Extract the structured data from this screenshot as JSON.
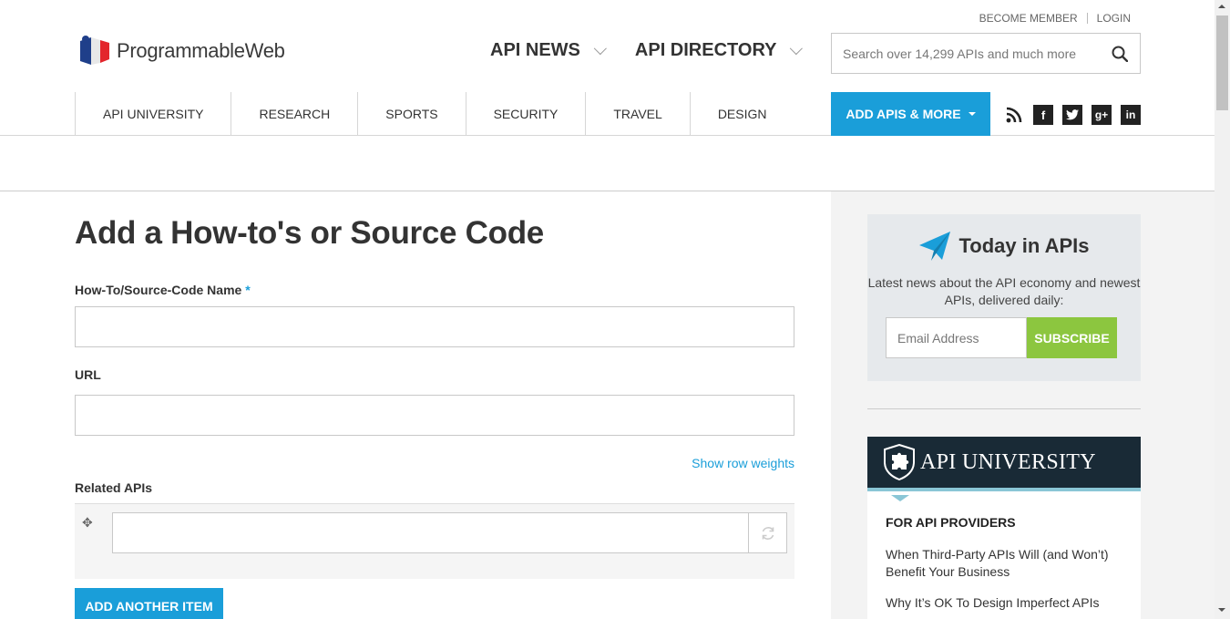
{
  "header": {
    "logo_text": "ProgrammableWeb",
    "top_links": {
      "become_member": "BECOME MEMBER",
      "login": "LOGIN"
    },
    "nav": [
      {
        "label": "API NEWS"
      },
      {
        "label": "API DIRECTORY"
      }
    ],
    "search": {
      "placeholder": "Search over 14,299 APIs and much more",
      "value": ""
    }
  },
  "subnav": {
    "items": [
      {
        "label": "API UNIVERSITY"
      },
      {
        "label": "RESEARCH"
      },
      {
        "label": "SPORTS"
      },
      {
        "label": "SECURITY"
      },
      {
        "label": "TRAVEL"
      },
      {
        "label": "DESIGN"
      }
    ],
    "add_button": "ADD APIS & MORE",
    "social_icons": [
      "rss-icon",
      "facebook-icon",
      "twitter-icon",
      "google-plus-icon",
      "linkedin-icon"
    ]
  },
  "form": {
    "title": "Add a How-to's or Source Code",
    "name_label": "How-To/Source-Code Name",
    "required_mark": "*",
    "name_value": "",
    "url_label": "URL",
    "url_value": "",
    "row_weights_link": "Show row weights",
    "related_label": "Related APIs",
    "related_value": "",
    "add_item_button": "ADD ANOTHER ITEM"
  },
  "sidebar": {
    "today": {
      "title": "Today in APIs",
      "description": "Latest news about the API economy and newest APIs, delivered daily:",
      "email_placeholder": "Email Address",
      "subscribe_label": "SUBSCRIBE"
    },
    "api_university": {
      "title": "API UNIVERSITY",
      "subheading": "FOR API PROVIDERS",
      "links": [
        "When Third-Party APIs Will (and Won’t) Benefit Your Business",
        "Why It’s OK To Design Imperfect APIs"
      ]
    }
  },
  "colors": {
    "accent_blue": "#1a9ed9",
    "subscribe_green": "#8cc63f",
    "api_university_bg": "#192a36"
  }
}
